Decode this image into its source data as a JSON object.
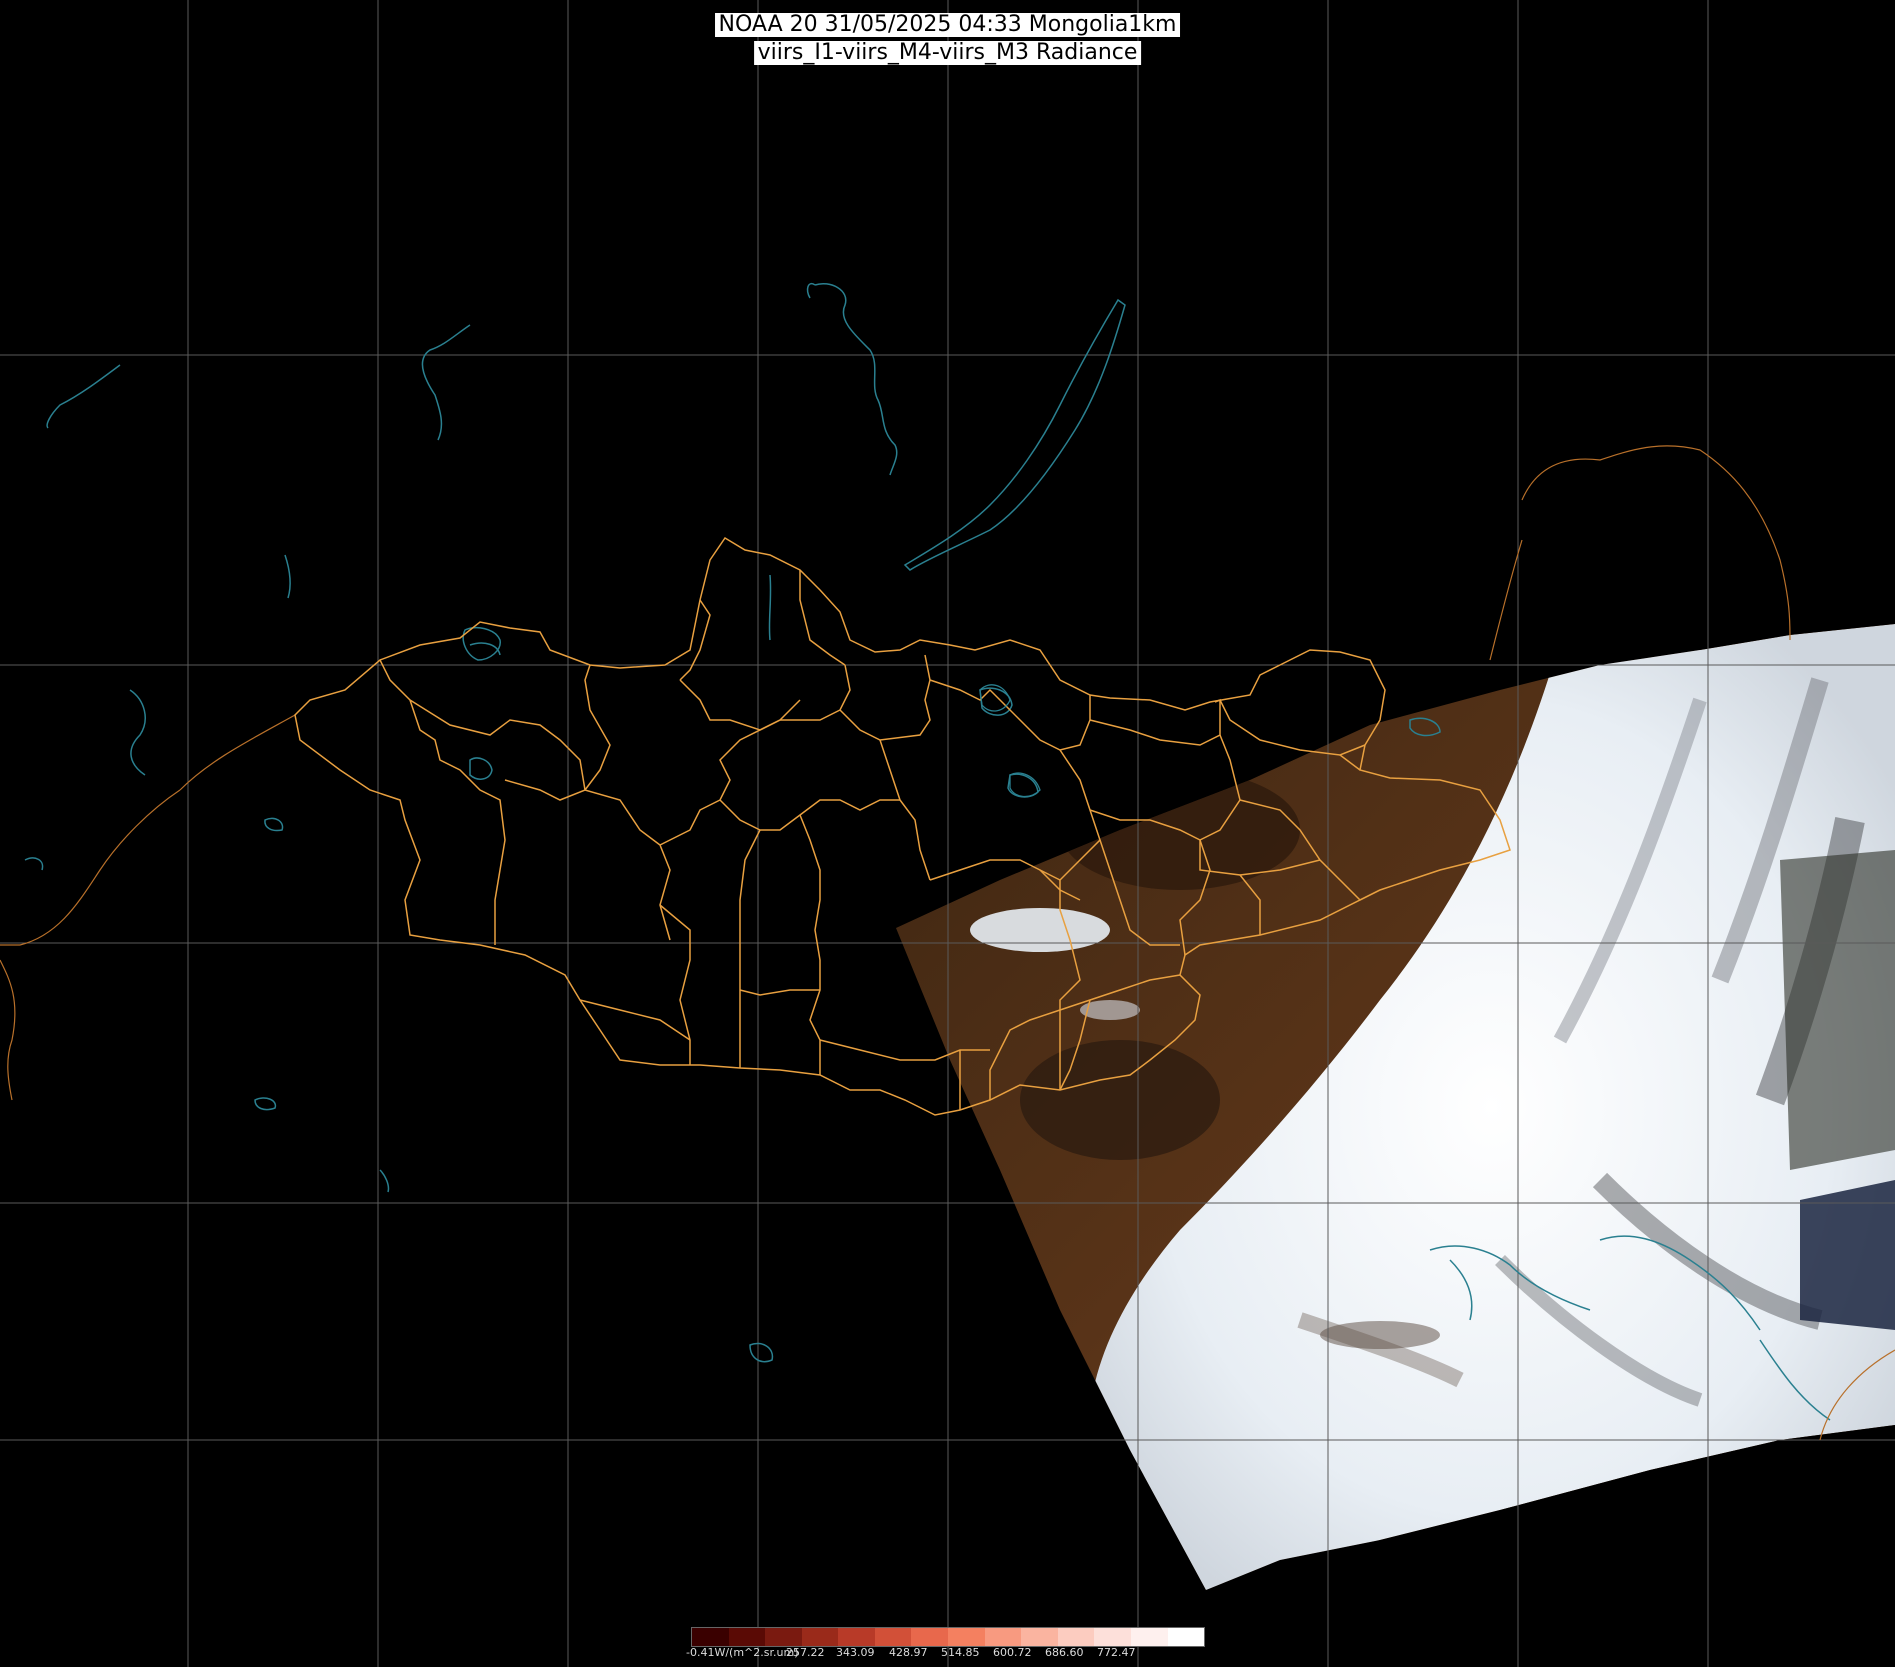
{
  "header": {
    "line1": "NOAA 20 31/05/2025 04:33 Mongolia1km",
    "line2": "viirs_I1-viirs_M4-viirs_M3 Radiance"
  },
  "legend": {
    "colors": [
      "#3a0000",
      "#5a0a05",
      "#7a1a10",
      "#9a2a1a",
      "#b83a28",
      "#d25038",
      "#e8684c",
      "#f48060",
      "#f89a80",
      "#fab4a0",
      "#fcccc0",
      "#fde0da",
      "#fef0ee",
      "#ffffff"
    ],
    "labels": [
      "-0.41W/(m^2.sr.um)",
      "257.22",
      "343.09",
      "428.97",
      "514.85",
      "600.72",
      "686.60",
      "772.47"
    ]
  },
  "colors": {
    "background": "#000000",
    "graticule": "#5a5a5a",
    "border": "#e8a040",
    "water": "#2a8090",
    "land": "#4a2a14",
    "cloud": "#f2f6fa"
  }
}
